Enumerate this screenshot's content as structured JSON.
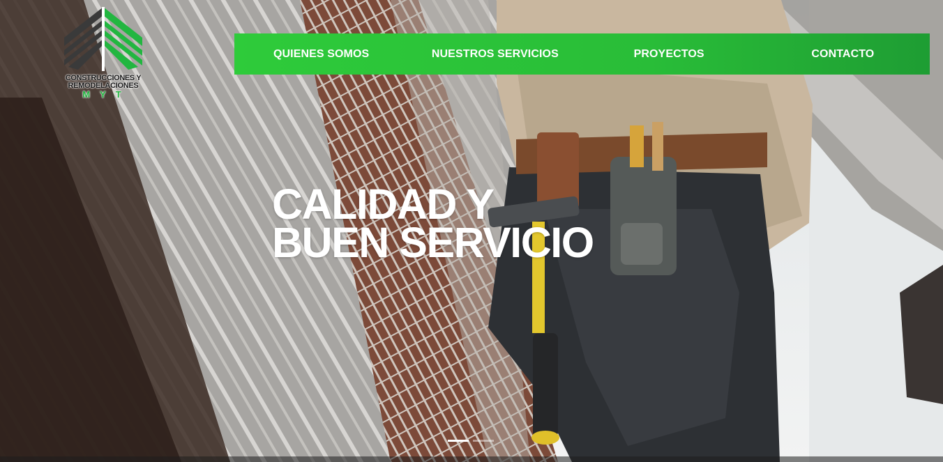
{
  "brand": {
    "line1": "CONSTRUCCIONES Y",
    "line2": "REMODELACIONES",
    "line3": "MYT"
  },
  "nav": {
    "items": [
      {
        "label": "QUIENES SOMOS"
      },
      {
        "label": "NUESTROS SERVICIOS"
      },
      {
        "label": "PROYECTOS"
      },
      {
        "label": "CONTACTO"
      }
    ]
  },
  "hero": {
    "line1": "CALIDAD Y",
    "line2": "BUEN SERVICIO",
    "slides_total": 2,
    "active_slide": 1
  },
  "colors": {
    "accent": "#2ecb3a",
    "logo_dark": "#3a3a3a",
    "logo_green": "#22b640"
  }
}
